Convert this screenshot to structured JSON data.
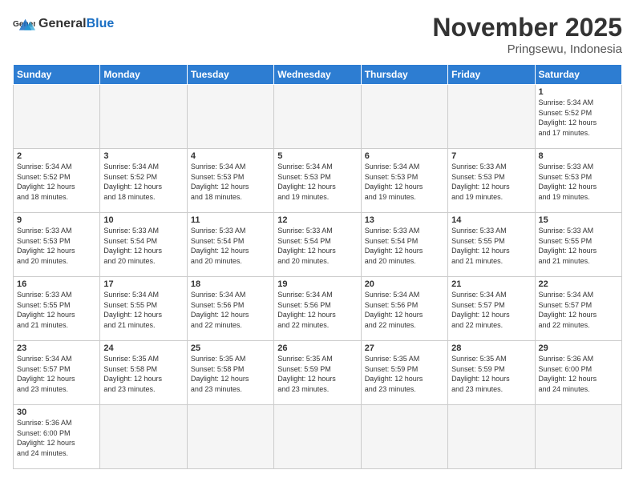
{
  "header": {
    "logo_general": "General",
    "logo_blue": "Blue",
    "month_title": "November 2025",
    "subtitle": "Pringsewu, Indonesia"
  },
  "weekdays": [
    "Sunday",
    "Monday",
    "Tuesday",
    "Wednesday",
    "Thursday",
    "Friday",
    "Saturday"
  ],
  "weeks": [
    [
      {
        "day": "",
        "info": ""
      },
      {
        "day": "",
        "info": ""
      },
      {
        "day": "",
        "info": ""
      },
      {
        "day": "",
        "info": ""
      },
      {
        "day": "",
        "info": ""
      },
      {
        "day": "",
        "info": ""
      },
      {
        "day": "1",
        "info": "Sunrise: 5:34 AM\nSunset: 5:52 PM\nDaylight: 12 hours\nand 17 minutes."
      }
    ],
    [
      {
        "day": "2",
        "info": "Sunrise: 5:34 AM\nSunset: 5:52 PM\nDaylight: 12 hours\nand 18 minutes."
      },
      {
        "day": "3",
        "info": "Sunrise: 5:34 AM\nSunset: 5:52 PM\nDaylight: 12 hours\nand 18 minutes."
      },
      {
        "day": "4",
        "info": "Sunrise: 5:34 AM\nSunset: 5:53 PM\nDaylight: 12 hours\nand 18 minutes."
      },
      {
        "day": "5",
        "info": "Sunrise: 5:34 AM\nSunset: 5:53 PM\nDaylight: 12 hours\nand 19 minutes."
      },
      {
        "day": "6",
        "info": "Sunrise: 5:34 AM\nSunset: 5:53 PM\nDaylight: 12 hours\nand 19 minutes."
      },
      {
        "day": "7",
        "info": "Sunrise: 5:33 AM\nSunset: 5:53 PM\nDaylight: 12 hours\nand 19 minutes."
      },
      {
        "day": "8",
        "info": "Sunrise: 5:33 AM\nSunset: 5:53 PM\nDaylight: 12 hours\nand 19 minutes."
      }
    ],
    [
      {
        "day": "9",
        "info": "Sunrise: 5:33 AM\nSunset: 5:53 PM\nDaylight: 12 hours\nand 20 minutes."
      },
      {
        "day": "10",
        "info": "Sunrise: 5:33 AM\nSunset: 5:54 PM\nDaylight: 12 hours\nand 20 minutes."
      },
      {
        "day": "11",
        "info": "Sunrise: 5:33 AM\nSunset: 5:54 PM\nDaylight: 12 hours\nand 20 minutes."
      },
      {
        "day": "12",
        "info": "Sunrise: 5:33 AM\nSunset: 5:54 PM\nDaylight: 12 hours\nand 20 minutes."
      },
      {
        "day": "13",
        "info": "Sunrise: 5:33 AM\nSunset: 5:54 PM\nDaylight: 12 hours\nand 20 minutes."
      },
      {
        "day": "14",
        "info": "Sunrise: 5:33 AM\nSunset: 5:55 PM\nDaylight: 12 hours\nand 21 minutes."
      },
      {
        "day": "15",
        "info": "Sunrise: 5:33 AM\nSunset: 5:55 PM\nDaylight: 12 hours\nand 21 minutes."
      }
    ],
    [
      {
        "day": "16",
        "info": "Sunrise: 5:33 AM\nSunset: 5:55 PM\nDaylight: 12 hours\nand 21 minutes."
      },
      {
        "day": "17",
        "info": "Sunrise: 5:34 AM\nSunset: 5:55 PM\nDaylight: 12 hours\nand 21 minutes."
      },
      {
        "day": "18",
        "info": "Sunrise: 5:34 AM\nSunset: 5:56 PM\nDaylight: 12 hours\nand 22 minutes."
      },
      {
        "day": "19",
        "info": "Sunrise: 5:34 AM\nSunset: 5:56 PM\nDaylight: 12 hours\nand 22 minutes."
      },
      {
        "day": "20",
        "info": "Sunrise: 5:34 AM\nSunset: 5:56 PM\nDaylight: 12 hours\nand 22 minutes."
      },
      {
        "day": "21",
        "info": "Sunrise: 5:34 AM\nSunset: 5:57 PM\nDaylight: 12 hours\nand 22 minutes."
      },
      {
        "day": "22",
        "info": "Sunrise: 5:34 AM\nSunset: 5:57 PM\nDaylight: 12 hours\nand 22 minutes."
      }
    ],
    [
      {
        "day": "23",
        "info": "Sunrise: 5:34 AM\nSunset: 5:57 PM\nDaylight: 12 hours\nand 23 minutes."
      },
      {
        "day": "24",
        "info": "Sunrise: 5:35 AM\nSunset: 5:58 PM\nDaylight: 12 hours\nand 23 minutes."
      },
      {
        "day": "25",
        "info": "Sunrise: 5:35 AM\nSunset: 5:58 PM\nDaylight: 12 hours\nand 23 minutes."
      },
      {
        "day": "26",
        "info": "Sunrise: 5:35 AM\nSunset: 5:59 PM\nDaylight: 12 hours\nand 23 minutes."
      },
      {
        "day": "27",
        "info": "Sunrise: 5:35 AM\nSunset: 5:59 PM\nDaylight: 12 hours\nand 23 minutes."
      },
      {
        "day": "28",
        "info": "Sunrise: 5:35 AM\nSunset: 5:59 PM\nDaylight: 12 hours\nand 23 minutes."
      },
      {
        "day": "29",
        "info": "Sunrise: 5:36 AM\nSunset: 6:00 PM\nDaylight: 12 hours\nand 24 minutes."
      }
    ],
    [
      {
        "day": "30",
        "info": "Sunrise: 5:36 AM\nSunset: 6:00 PM\nDaylight: 12 hours\nand 24 minutes."
      },
      {
        "day": "",
        "info": ""
      },
      {
        "day": "",
        "info": ""
      },
      {
        "day": "",
        "info": ""
      },
      {
        "day": "",
        "info": ""
      },
      {
        "day": "",
        "info": ""
      },
      {
        "day": "",
        "info": ""
      }
    ]
  ]
}
